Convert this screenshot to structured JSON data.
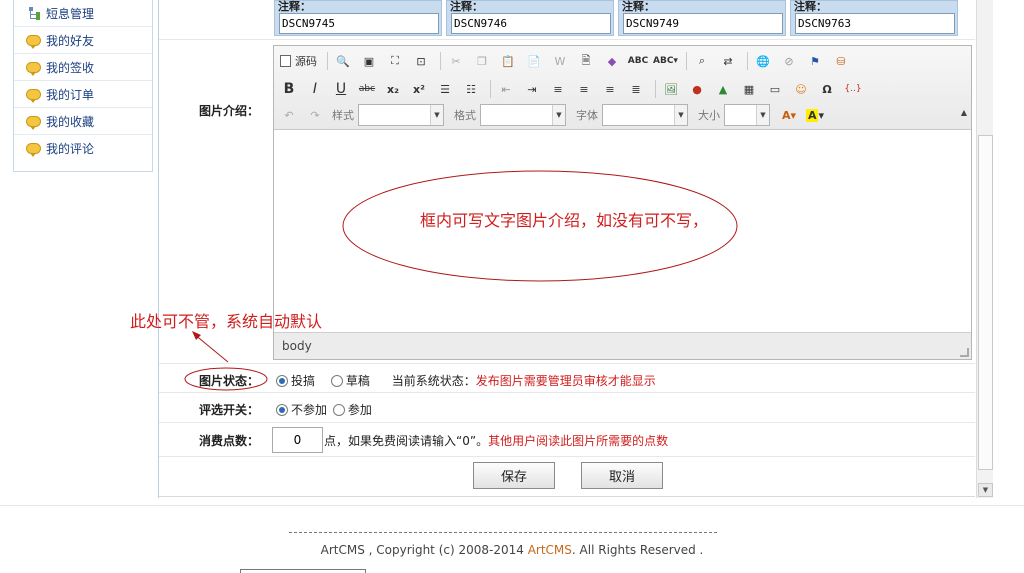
{
  "sidebar": {
    "items": [
      {
        "label": "短息管理",
        "icon": "tree-icon"
      },
      {
        "label": "我的好友",
        "icon": "speech-bubble-icon"
      },
      {
        "label": "我的签收",
        "icon": "speech-bubble-icon"
      },
      {
        "label": "我的订单",
        "icon": "speech-bubble-icon"
      },
      {
        "label": "我的收藏",
        "icon": "speech-bubble-icon"
      },
      {
        "label": "我的评论",
        "icon": "speech-bubble-icon"
      }
    ]
  },
  "photo_titles": {
    "label": "注释：",
    "values": [
      "DSCN9745",
      "DSCN9746",
      "DSCN9749",
      "DSCN9763"
    ]
  },
  "form": {
    "intro_label": "图片介绍：",
    "status_label": "图片状态：",
    "status_options": [
      "投搞",
      "草稿"
    ],
    "status_selected": "投搞",
    "system_status_prefix": "当前系统状态：",
    "system_status_value": "发布图片需要管理员审核才能显示",
    "vote_label": "评选开关：",
    "vote_options": [
      "不参加",
      "参加"
    ],
    "vote_selected": "不参加",
    "points_label": "消费点数：",
    "points_value": "0",
    "points_hint": "点，如果免费阅读请输入“0”。",
    "points_hint_red": "其他用户阅读此图片所需要的点数",
    "save_label": "保存",
    "cancel_label": "取消"
  },
  "editor": {
    "source_label": "源码",
    "style_label": "样式",
    "format_label": "格式",
    "font_label": "字体",
    "size_label": "大小",
    "path_text": "body"
  },
  "annotations": {
    "editor_note": "框内可写文字图片介绍，如没有可不写，",
    "status_note": "此处可不管，系统自动默认"
  },
  "footer": {
    "prefix": "ArtCMS , Copyright (c) 2008-2014 ",
    "brand": "ArtCMS",
    "suffix": ". All Rights Reserved ."
  },
  "colors": {
    "annotation_red": "#d01d1d",
    "brand_orange": "#c86a1a",
    "link_blue": "#1a3f80"
  }
}
